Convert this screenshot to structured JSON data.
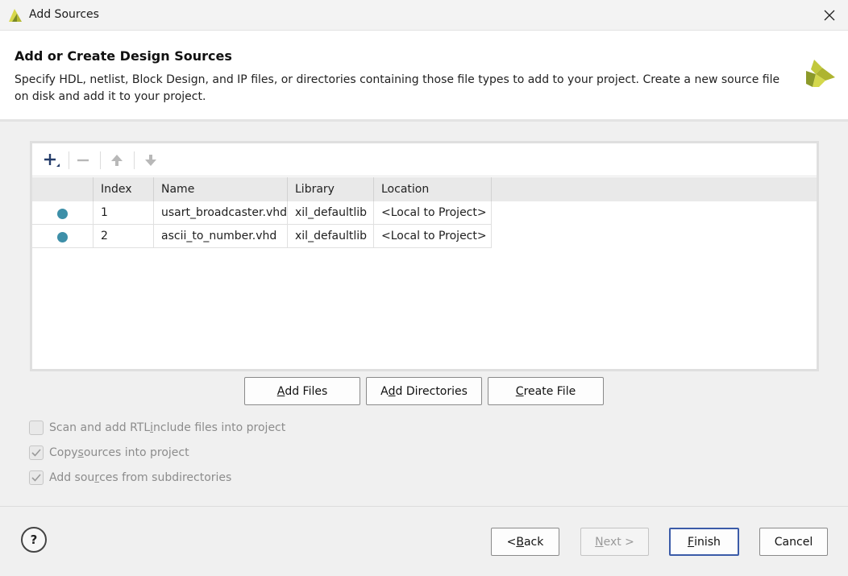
{
  "window": {
    "title": "Add Sources"
  },
  "header": {
    "title": "Add or Create Design Sources",
    "description": "Specify HDL, netlist, Block Design, and IP files, or directories containing those file types to add to your project. Create a new source file on disk and add it to your project."
  },
  "table": {
    "columns": [
      "",
      "Index",
      "Name",
      "Library",
      "Location"
    ],
    "rows": [
      {
        "index": "1",
        "name": "usart_broadcaster.vhd",
        "library": "xil_defaultlib",
        "location": "<Local to Project>"
      },
      {
        "index": "2",
        "name": "ascii_to_number.vhd",
        "library": "xil_defaultlib",
        "location": "<Local to Project>"
      }
    ]
  },
  "actions": {
    "add_files": {
      "pre": "",
      "key": "A",
      "post": "dd Files"
    },
    "add_dirs": {
      "pre": "A",
      "key": "d",
      "post": "d Directories"
    },
    "create_file": {
      "pre": "",
      "key": "C",
      "post": "reate File"
    }
  },
  "options": {
    "scan": {
      "pre": "Scan and add RTL ",
      "key": "i",
      "post": "nclude files into project",
      "checked": false
    },
    "copy": {
      "pre": "Copy ",
      "key": "s",
      "post": "ources into project",
      "checked": true
    },
    "subdirs": {
      "pre": "Add sou",
      "key": "r",
      "post": "ces from subdirectories",
      "checked": true
    }
  },
  "footer": {
    "help": "?",
    "back": {
      "pre": "< ",
      "key": "B",
      "post": "ack"
    },
    "next": {
      "pre": "",
      "key": "N",
      "post": "ext >"
    },
    "finish": {
      "pre": "",
      "key": "F",
      "post": "inish"
    },
    "cancel": "Cancel"
  },
  "colors": {
    "status_dot": "#3d8fa8",
    "logo": "#c2c83c",
    "primary_border": "#3b5ba8"
  },
  "icons": {
    "add": "plus-icon",
    "remove": "minus-icon",
    "up": "arrow-up-icon",
    "down": "arrow-down-icon",
    "close": "close-icon"
  }
}
